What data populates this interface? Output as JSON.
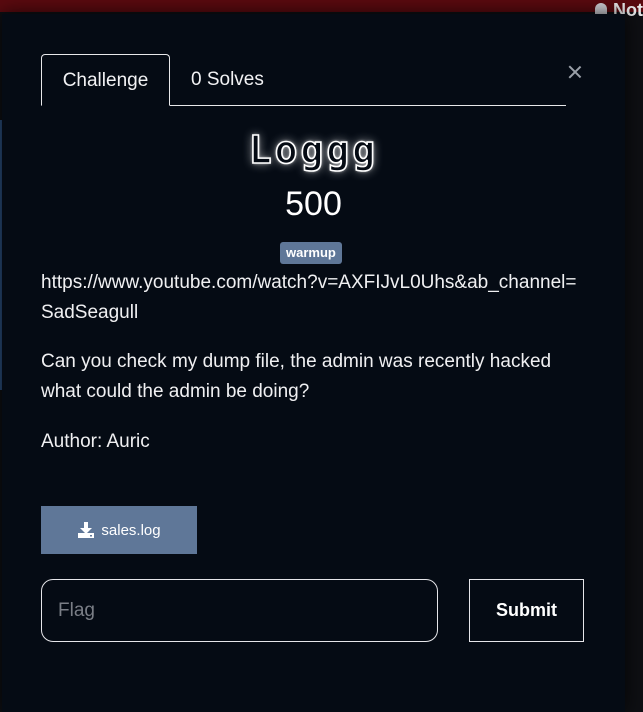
{
  "page": {
    "notification_text": "Not"
  },
  "modal": {
    "tabs": [
      {
        "label": "Challenge",
        "active": true
      },
      {
        "label": "0 Solves",
        "active": false
      }
    ],
    "title": "Loggg",
    "points": "500",
    "tag": "warmup",
    "description": {
      "link": "https://www.youtube.com/watch?v=AXFIJvL0Uhs&ab_channel=SadSeagull",
      "paragraph": "Can you check my dump file, the admin was recently hacked what could the admin be doing?",
      "author": "Author: Auric"
    },
    "file": {
      "name": "sales.log",
      "icon": "download-icon"
    },
    "flag_input": {
      "placeholder": "Flag",
      "value": ""
    },
    "submit_label": "Submit"
  },
  "colors": {
    "modal_bg": "#050b14",
    "accent": "#5f7798",
    "header_bar": "#5a0a0f",
    "text": "#f0f0f2"
  }
}
